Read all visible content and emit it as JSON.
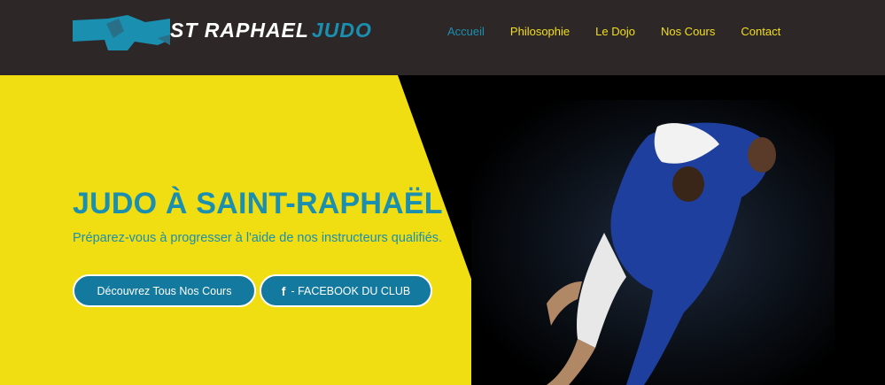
{
  "header": {
    "logo": {
      "text_primary": "ST RAPHAEL",
      "text_secondary": "JUDO",
      "belt_color": "#1a8fb0"
    },
    "nav": [
      {
        "label": "Accueil",
        "active": true
      },
      {
        "label": "Philosophie",
        "active": false
      },
      {
        "label": "Le Dojo",
        "active": false
      },
      {
        "label": "Nos Cours",
        "active": false
      },
      {
        "label": "Contact",
        "active": false
      }
    ]
  },
  "hero": {
    "title": "JUDO À SAINT-RAPHAËL",
    "subtitle": "Préparez-vous à progresser à l'aide de nos instructeurs qualifiés.",
    "buttons": {
      "primary": "Découvrez Tous Nos Cours",
      "facebook_icon": "f",
      "facebook": "- FACEBOOK DU CLUB"
    }
  },
  "colors": {
    "header_bg": "#2d2727",
    "accent_yellow": "#f0dd12",
    "accent_blue": "#1a8fb0",
    "button_bg": "#13799e"
  }
}
